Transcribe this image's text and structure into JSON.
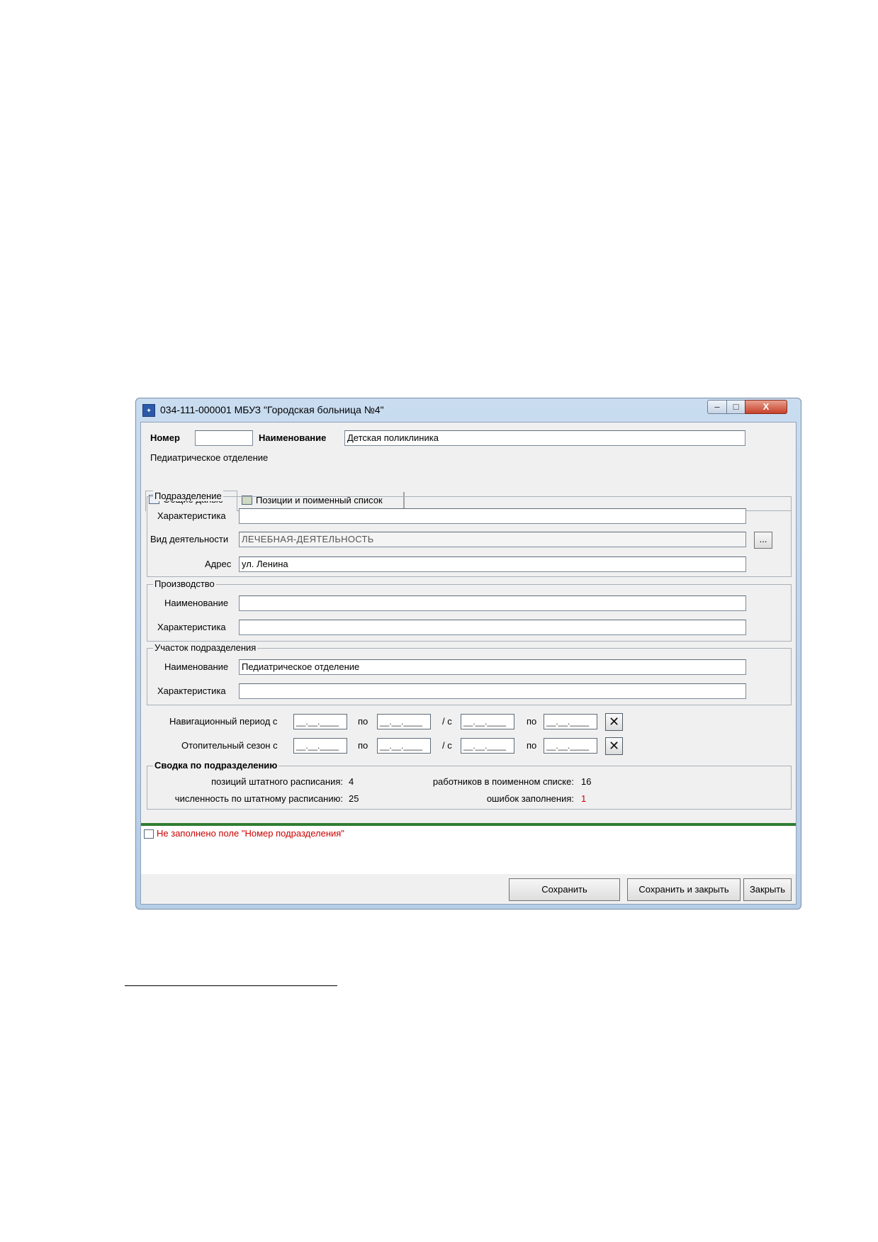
{
  "window": {
    "title": "034-111-000001 МБУЗ  \"Городская больница №4\"",
    "controls": {
      "minimize": "–",
      "maximize": "□",
      "close": "X"
    }
  },
  "header": {
    "number_label": "Номер",
    "number_value": "",
    "name_label": "Наименование",
    "name_value": "Детская поликлиника",
    "subtitle": "Педиатрическое отделение"
  },
  "tabs": [
    {
      "label": "Общие даные",
      "icon": "document-icon",
      "active": true
    },
    {
      "label": "Позиции и поименный список",
      "icon": "people-icon",
      "active": false
    }
  ],
  "subdivision": {
    "title": "Подразделение",
    "characteristic_label": "Характеристика",
    "characteristic_value": "",
    "activity_label": "Вид деятельности",
    "activity_value": "ЛЕЧЕБНАЯ-ДЕЯТЕЛЬНОСТЬ",
    "activity_button": "...",
    "address_label": "Адрес",
    "address_value": "ул. Ленина"
  },
  "production": {
    "title": "Производство",
    "name_label": "Наименование",
    "name_value": "",
    "characteristic_label": "Характеристика",
    "characteristic_value": ""
  },
  "section": {
    "title": "Участок подразделения",
    "name_label": "Наименование",
    "name_value": "Педиатрическое отделение",
    "characteristic_label": "Характеристика",
    "characteristic_value": ""
  },
  "periods": {
    "date_mask": "__.__.____",
    "to_label": "по",
    "from2_label": "/ с",
    "clear_glyph": "✕",
    "navigation_label": "Навигационный период с",
    "heating_label": "Отопительный сезон с"
  },
  "summary": {
    "title": "Сводка по подразделению",
    "positions_label": "позиций штатного расписания:",
    "positions_value": "4",
    "staff_count_label": "численность по штатному расписанию:",
    "staff_count_value": "25",
    "employees_label": "работников в поименном списке:",
    "employees_value": "16",
    "errors_label": "ошибок заполнения:",
    "errors_value": "1",
    "errors_color": "#cc0000"
  },
  "messages": [
    {
      "text": "Не заполнено поле \"Номер подразделения\"",
      "color": "#cc0000"
    }
  ],
  "buttons": {
    "save": "Сохранить",
    "save_close": "Сохранить и закрыть",
    "close": "Закрыть"
  },
  "accent_colors": {
    "status_bar": "#2e7d32",
    "title_bar": "#c9dcf0"
  }
}
